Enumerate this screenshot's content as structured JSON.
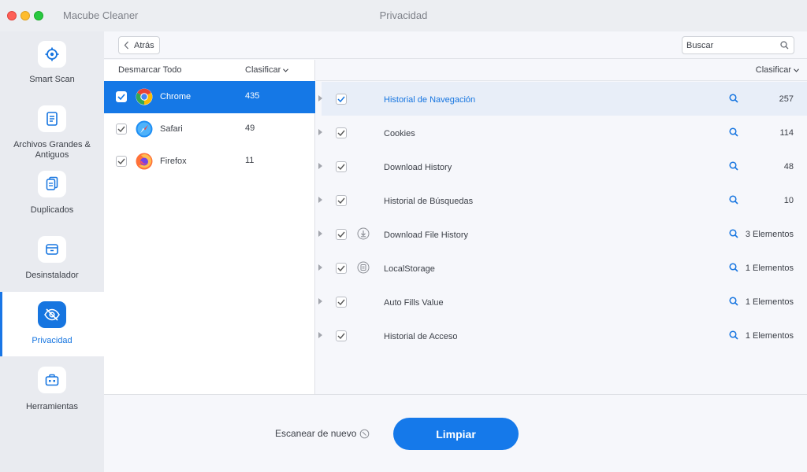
{
  "app": {
    "name": "Macube Cleaner",
    "window_title": "Privacidad"
  },
  "nav": {
    "items": [
      {
        "label": "Smart Scan",
        "icon": "smart-scan-icon",
        "active": false
      },
      {
        "label": "Archivos Grandes & Antiguos",
        "icon": "large-files-icon",
        "active": false
      },
      {
        "label": "Duplicados",
        "icon": "duplicates-icon",
        "active": false
      },
      {
        "label": "Desinstalador",
        "icon": "uninstaller-icon",
        "active": false
      },
      {
        "label": "Privacidad",
        "icon": "privacy-eye-slash-icon",
        "active": true
      },
      {
        "label": "Herramientas",
        "icon": "toolbox-icon",
        "active": false
      }
    ]
  },
  "toolbar": {
    "back_label": "Atrás",
    "search_placeholder": "Buscar"
  },
  "browser_list": {
    "header_uncheck_all": "Desmarcar Todo",
    "header_sort": "Clasificar",
    "items": [
      {
        "name": "Chrome",
        "count": "435",
        "checked": true,
        "selected": true
      },
      {
        "name": "Safari",
        "count": "49",
        "checked": true,
        "selected": false
      },
      {
        "name": "Firefox",
        "count": "11",
        "checked": true,
        "selected": false
      }
    ]
  },
  "details": {
    "header_sort": "Clasificar",
    "items": [
      {
        "name": "Historial de Navegación",
        "count": "257",
        "checked": true,
        "highlighted": true,
        "icon": ""
      },
      {
        "name": "Cookies",
        "count": "114",
        "checked": true,
        "highlighted": false,
        "icon": ""
      },
      {
        "name": "Download History",
        "count": "48",
        "checked": true,
        "highlighted": false,
        "icon": ""
      },
      {
        "name": "Historial de Búsquedas",
        "count": "10",
        "checked": true,
        "highlighted": false,
        "icon": ""
      },
      {
        "name": "Download File History",
        "count": "3 Elementos",
        "checked": true,
        "highlighted": false,
        "icon": "download-circle-icon"
      },
      {
        "name": "LocalStorage",
        "count": "1 Elementos",
        "checked": true,
        "highlighted": false,
        "icon": "storage-circle-icon"
      },
      {
        "name": "Auto Fills Value",
        "count": "1 Elementos",
        "checked": true,
        "highlighted": false,
        "icon": ""
      },
      {
        "name": "Historial de Acceso",
        "count": "1 Elementos",
        "checked": true,
        "highlighted": false,
        "icon": ""
      }
    ]
  },
  "footer": {
    "rescan_label": "Escanear de nuevo",
    "clean_label": "Limpiar"
  },
  "colors": {
    "accent": "#1675e0",
    "selected_row": "#1578e6",
    "highlight_row": "#e8eef8"
  }
}
